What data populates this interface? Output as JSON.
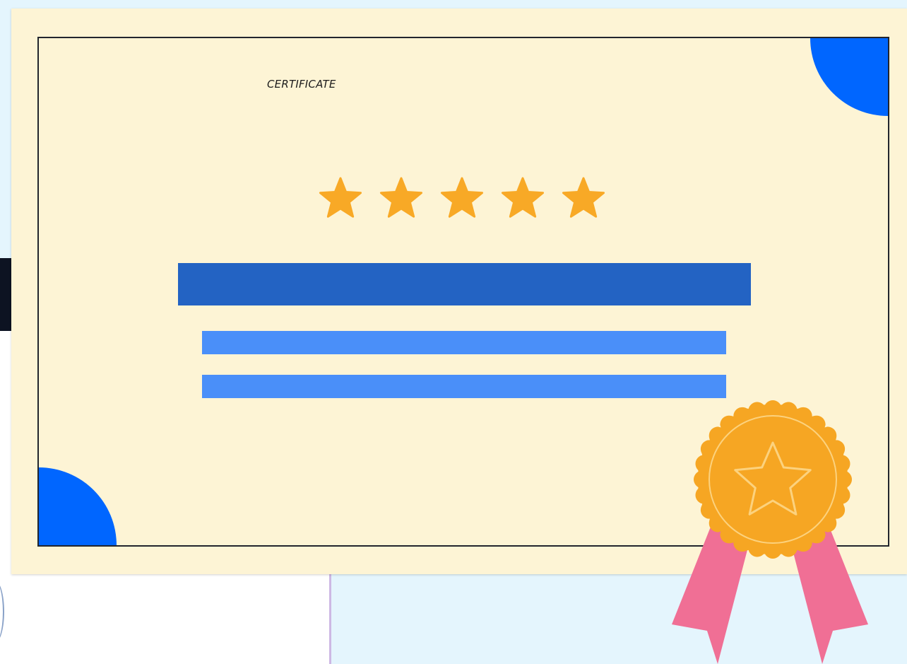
{
  "certificate": {
    "title": "CERTIFICATE",
    "rating": {
      "value": 5,
      "max": 5,
      "icon": "star-icon",
      "color": "#f8a926"
    },
    "text_placeholder_lines": 3
  },
  "award_badge": {
    "icon": "star-icon",
    "medal_color": "#f6a623",
    "ribbon_color": "#f06f95"
  },
  "colors": {
    "paper": "#fdf4d5",
    "corner_accent": "#0066ff",
    "title_bar": "#2363c3",
    "text_bar": "#4a8ff9",
    "background": "#e4f5fd",
    "frame": "#22252d"
  }
}
